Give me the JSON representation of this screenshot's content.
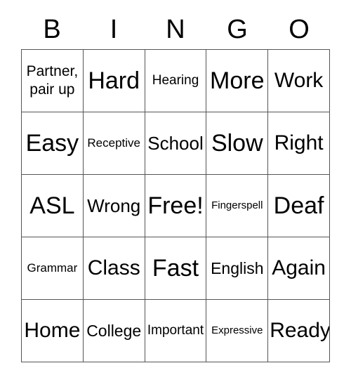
{
  "card": {
    "header_letters": [
      "B",
      "I",
      "N",
      "G",
      "O"
    ],
    "columns": 5,
    "rows": 5,
    "free_space_label": "Free!",
    "free_space_position": {
      "row": 3,
      "column": 3
    },
    "border_color": "#555555",
    "background_color": "#ffffff",
    "text_color": "#000000",
    "grid": [
      [
        {
          "text": "Partner,\npair up",
          "size": "two-line"
        },
        {
          "text": "Hard",
          "size": "sz-xl"
        },
        {
          "text": "Hearing",
          "size": "sz-xs"
        },
        {
          "text": "More",
          "size": "sz-xl"
        },
        {
          "text": "Work",
          "size": "sz-lg"
        }
      ],
      [
        {
          "text": "Easy",
          "size": "sz-xl"
        },
        {
          "text": "Receptive",
          "size": "sz-xxs"
        },
        {
          "text": "School",
          "size": "sz-md"
        },
        {
          "text": "Slow",
          "size": "sz-xl"
        },
        {
          "text": "Right",
          "size": "sz-lg"
        }
      ],
      [
        {
          "text": "ASL",
          "size": "sz-xl"
        },
        {
          "text": "Wrong",
          "size": "sz-md"
        },
        {
          "text": "Free!",
          "size": "sz-xl"
        },
        {
          "text": "Fingerspell",
          "size": "sz-tiny"
        },
        {
          "text": "Deaf",
          "size": "sz-xl"
        }
      ],
      [
        {
          "text": "Grammar",
          "size": "sz-xxs"
        },
        {
          "text": "Class",
          "size": "sz-lg"
        },
        {
          "text": "Fast",
          "size": "sz-xl"
        },
        {
          "text": "English",
          "size": "sz-sm"
        },
        {
          "text": "Again",
          "size": "sz-lg"
        }
      ],
      [
        {
          "text": "Home",
          "size": "sz-lg"
        },
        {
          "text": "College",
          "size": "sz-sm"
        },
        {
          "text": "Important",
          "size": "sz-xs"
        },
        {
          "text": "Expressive",
          "size": "sz-tiny"
        },
        {
          "text": "Ready",
          "size": "sz-lg"
        }
      ]
    ]
  }
}
